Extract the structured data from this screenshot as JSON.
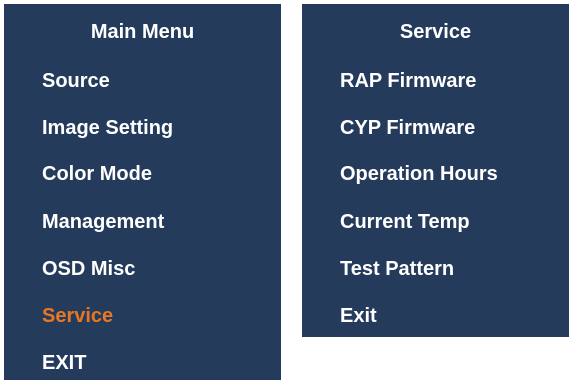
{
  "main_menu": {
    "title": "Main Menu",
    "items": [
      {
        "label": "Source"
      },
      {
        "label": "Image Setting"
      },
      {
        "label": "Color Mode"
      },
      {
        "label": "Management"
      },
      {
        "label": "OSD Misc"
      },
      {
        "label": "Service",
        "selected": true
      },
      {
        "label": "EXIT"
      }
    ]
  },
  "service_menu": {
    "title": "Service",
    "items": [
      {
        "label": "RAP Firmware"
      },
      {
        "label": "CYP Firmware"
      },
      {
        "label": "Operation Hours"
      },
      {
        "label": "Current Temp"
      },
      {
        "label": "Test Pattern"
      },
      {
        "label": "Exit"
      }
    ]
  },
  "colors": {
    "panel_background": "#243b5c",
    "text": "#ffffff",
    "selected_text": "#e87722"
  }
}
